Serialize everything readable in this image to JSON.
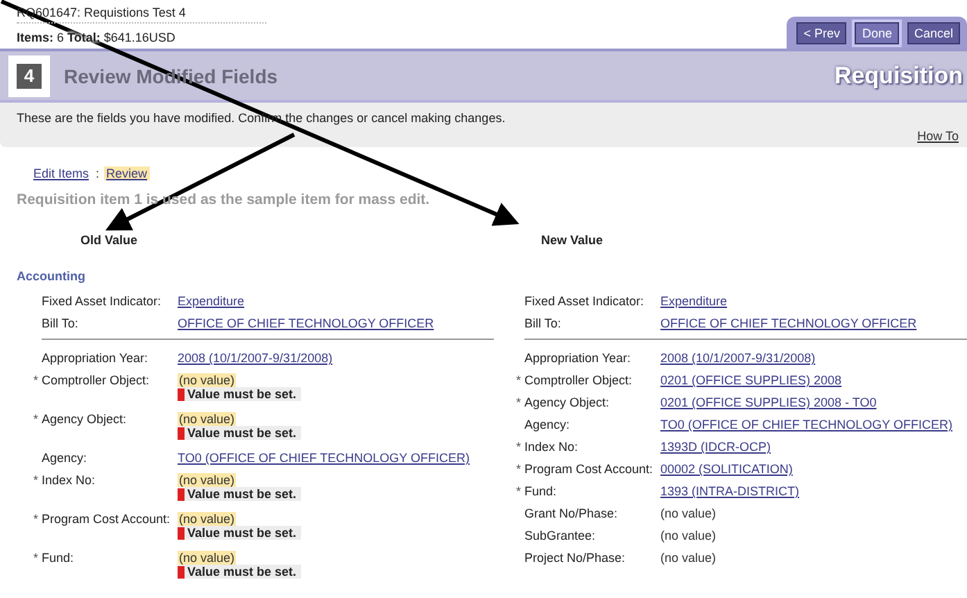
{
  "header": {
    "requisition": "RQ601647: Requistions Test 4",
    "items_label": "Items:",
    "items_value": "6",
    "total_label": "Total:",
    "total_value": "$641.16USD"
  },
  "buttons": [
    {
      "label": "< Prev",
      "selected": false
    },
    {
      "label": "Done",
      "selected": true
    },
    {
      "label": "Cancel",
      "selected": false
    }
  ],
  "step": {
    "number": "4",
    "title": "Review Modified Fields",
    "section": "Requisition",
    "info": "These are the fields you have modified. Confirm the changes or cancel making changes.",
    "how_to": "How To"
  },
  "breadcrumb": [
    {
      "label": "Edit Items",
      "selected": false
    },
    {
      "label": "Review",
      "selected": true
    }
  ],
  "breadcrumb_separator": ":",
  "note": "Requisition item 1 is used as the sample item for mass edit.",
  "section_title": "Accounting",
  "required_marker": "*",
  "columns": [
    {
      "header": "Old Value",
      "groups": [
        [
          {
            "label": "Fixed Asset Indicator:",
            "required": false,
            "kind": "link",
            "value": "Expenditure"
          },
          {
            "label": "Bill To:",
            "required": false,
            "kind": "link",
            "value": "OFFICE OF CHIEF TECHNOLOGY OFFICER"
          }
        ],
        [
          {
            "label": "Appropriation Year:",
            "required": false,
            "kind": "link",
            "value": "2008 (10/1/2007-9/31/2008)"
          },
          {
            "label": "Comptroller Object:",
            "required": true,
            "kind": "missing",
            "value": "(no value)",
            "error": "Value must be set."
          },
          {
            "label": "Agency Object:",
            "required": true,
            "kind": "missing",
            "value": "(no value)",
            "error": "Value must be set."
          },
          {
            "label": "Agency:",
            "required": false,
            "kind": "link",
            "value": "TO0 (OFFICE OF CHIEF TECHNOLOGY OFFICER)"
          },
          {
            "label": "Index No:",
            "required": true,
            "kind": "missing",
            "value": "(no value)",
            "error": "Value must be set."
          },
          {
            "label": "Program Cost Account:",
            "required": true,
            "kind": "missing",
            "value": "(no value)",
            "error": "Value must be set."
          },
          {
            "label": "Fund:",
            "required": true,
            "kind": "missing",
            "value": "(no value)",
            "error": "Value must be set."
          }
        ]
      ]
    },
    {
      "header": "New Value",
      "groups": [
        [
          {
            "label": "Fixed Asset Indicator:",
            "required": false,
            "kind": "link",
            "value": "Expenditure"
          },
          {
            "label": "Bill To:",
            "required": false,
            "kind": "link",
            "value": "OFFICE OF CHIEF TECHNOLOGY OFFICER"
          }
        ],
        [
          {
            "label": "Appropriation Year:",
            "required": false,
            "kind": "link",
            "value": "2008 (10/1/2007-9/31/2008)"
          },
          {
            "label": "Comptroller Object:",
            "required": true,
            "kind": "link",
            "value": "0201 (OFFICE SUPPLIES) 2008"
          },
          {
            "label": "Agency Object:",
            "required": true,
            "kind": "link",
            "value": "0201 (OFFICE SUPPLIES) 2008 - TO0"
          },
          {
            "label": "Agency:",
            "required": false,
            "kind": "link",
            "value": "TO0 (OFFICE OF CHIEF TECHNOLOGY OFFICER)"
          },
          {
            "label": "Index No:",
            "required": true,
            "kind": "link",
            "value": "1393D (IDCR-OCP)"
          },
          {
            "label": "Program Cost Account:",
            "required": true,
            "kind": "link",
            "value": "00002 (SOLITICATION)"
          },
          {
            "label": "Fund:",
            "required": true,
            "kind": "link",
            "value": "1393 (INTRA-DISTRICT)"
          },
          {
            "label": "Grant No/Phase:",
            "required": false,
            "kind": "plain",
            "value": "(no value)"
          },
          {
            "label": "SubGrantee:",
            "required": false,
            "kind": "plain",
            "value": "(no value)"
          },
          {
            "label": "Project No/Phase:",
            "required": false,
            "kind": "plain",
            "value": "(no value)"
          }
        ]
      ]
    }
  ]
}
